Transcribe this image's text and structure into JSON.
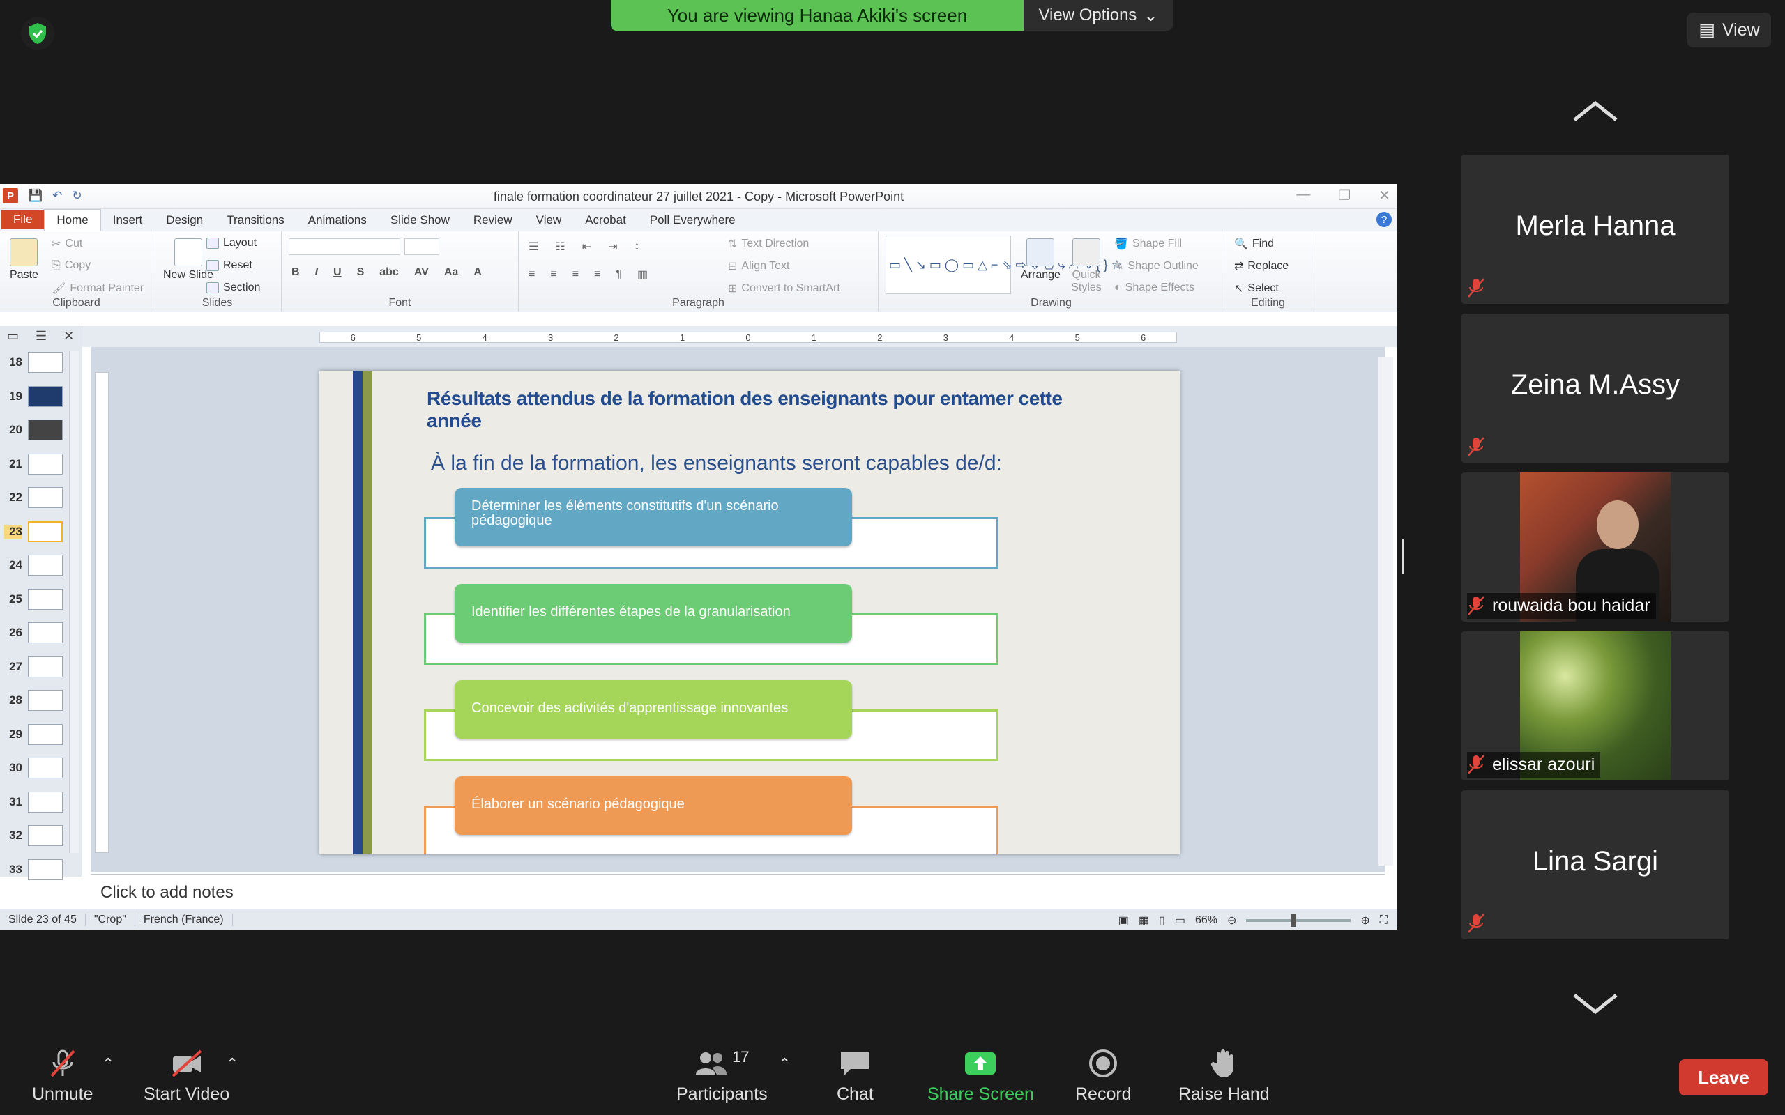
{
  "zoom": {
    "viewing_banner": "You are viewing Hanaa Akiki's screen",
    "view_options_label": "View Options",
    "view_label": "View"
  },
  "ppt": {
    "window_title": "finale formation coordinateur 27 juillet 2021 - Copy  -  Microsoft PowerPoint",
    "tabs": [
      "File",
      "Home",
      "Insert",
      "Design",
      "Transitions",
      "Animations",
      "Slide Show",
      "Review",
      "View",
      "Acrobat",
      "Poll Everywhere"
    ],
    "ribbon": {
      "paste": "Paste",
      "cut": "Cut",
      "copy": "Copy",
      "format_painter": "Format Painter",
      "clipboard": "Clipboard",
      "new_slide": "New Slide",
      "layout": "Layout",
      "reset": "Reset",
      "section": "Section",
      "slides": "Slides",
      "font": "Font",
      "paragraph": "Paragraph",
      "text_direction": "Text Direction",
      "align_text": "Align Text",
      "convert_smartart": "Convert to SmartArt",
      "arrange": "Arrange",
      "quick_styles": "Quick Styles",
      "shape_fill": "Shape Fill",
      "shape_outline": "Shape Outline",
      "shape_effects": "Shape Effects",
      "drawing": "Drawing",
      "find": "Find",
      "replace": "Replace",
      "select": "Select",
      "editing": "Editing"
    },
    "ruler_ticks": [
      "6",
      "5",
      "4",
      "3",
      "2",
      "1",
      "0",
      "1",
      "2",
      "3",
      "4",
      "5",
      "6"
    ],
    "thumbnails": [
      "18",
      "19",
      "20",
      "21",
      "22",
      "23",
      "24",
      "25",
      "26",
      "27",
      "28",
      "29",
      "30",
      "31",
      "32",
      "33"
    ],
    "selected_thumbnail": "23",
    "slide": {
      "title": "Résultats attendus de la formation des enseignants pour entamer cette année",
      "subtitle": "À  la fin de la formation, les enseignants seront capables de/d:",
      "items": [
        {
          "text": "Déterminer les éléments constitutifs d'un scénario pédagogique",
          "fill": "#62a8c5",
          "border": "#62a8c5"
        },
        {
          "text": "Identifier les différentes étapes de la granularisation",
          "fill": "#6ccb75",
          "border": "#6ccb75"
        },
        {
          "text": "Concevoir des activités d'apprentissage innovantes",
          "fill": "#a5d65a",
          "border": "#a5d65a"
        },
        {
          "text": "Élaborer un scénario pédagogique",
          "fill": "#ee9a55",
          "border": "#ee9a55"
        }
      ]
    },
    "notes_placeholder": "Click to add notes",
    "status": {
      "slide_count": "Slide 23 of 45",
      "theme": "\"Crop\"",
      "language": "French (France)",
      "zoom": "66%"
    }
  },
  "participants": [
    {
      "name": "Merla Hanna",
      "video": false
    },
    {
      "name": "Zeina M.Assy",
      "video": false
    },
    {
      "name": "rouwaida bou haidar",
      "video": true
    },
    {
      "name": "elissar azouri",
      "video": true
    },
    {
      "name": "Lina Sargi",
      "video": false
    }
  ],
  "toolbar": {
    "unmute": "Unmute",
    "start_video": "Start Video",
    "participants": "Participants",
    "participants_count": "17",
    "chat": "Chat",
    "share_screen": "Share Screen",
    "record": "Record",
    "raise_hand": "Raise Hand",
    "leave": "Leave"
  },
  "colors": {
    "viewing_green": "#5cc254",
    "leave_red": "#d03a2f",
    "share_green": "#3ccf5c",
    "slide_title_blue": "#234b8f"
  }
}
